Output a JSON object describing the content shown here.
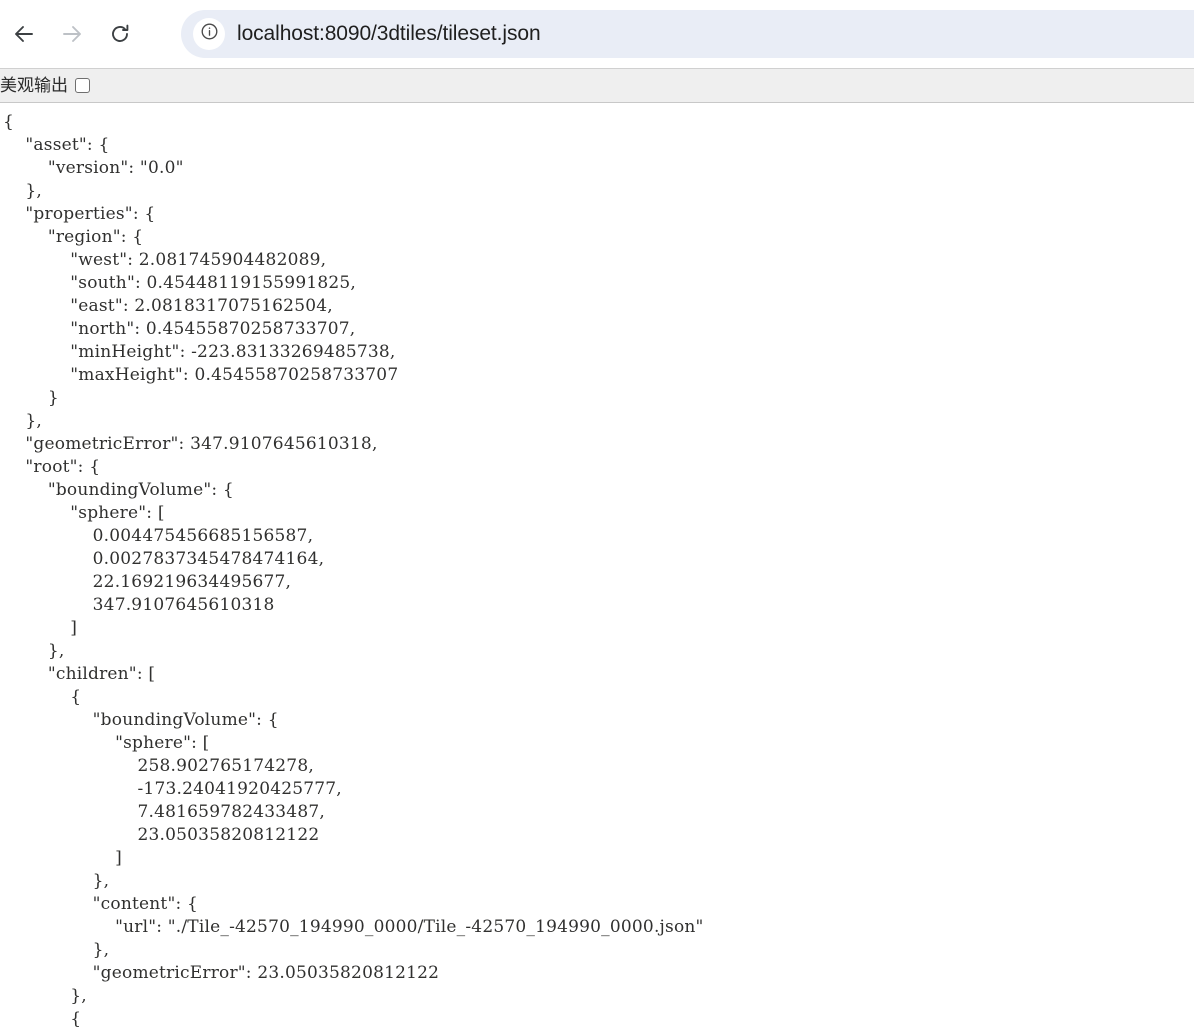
{
  "browser": {
    "back_label": "Back",
    "forward_label": "Forward",
    "reload_label": "Reload",
    "site_info_label": "View site information",
    "url": "localhost:8090/3dtiles/tileset.json"
  },
  "toolbar": {
    "pretty_print_label": "美观输出",
    "pretty_print_checked": false
  },
  "colors": {
    "omnibox_background": "#e9edf6",
    "toolbar_background": "#efefef",
    "page_background": "#ffffff",
    "text": "#30302f",
    "nav_enabled": "#3c4043",
    "nav_disabled": "#bdc1c6"
  },
  "document": {
    "filename": "tileset.json",
    "text": "{\n    \"asset\": {\n        \"version\": \"0.0\"\n    },\n    \"properties\": {\n        \"region\": {\n            \"west\": 2.081745904482089,\n            \"south\": 0.45448119155991825,\n            \"east\": 2.0818317075162504,\n            \"north\": 0.45455870258733707,\n            \"minHeight\": -223.83133269485738,\n            \"maxHeight\": 0.45455870258733707\n        }\n    },\n    \"geometricError\": 347.9107645610318,\n    \"root\": {\n        \"boundingVolume\": {\n            \"sphere\": [\n                0.004475456685156587,\n                0.0027837345478474164,\n                22.169219634495677,\n                347.9107645610318\n            ]\n        },\n        \"children\": [\n            {\n                \"boundingVolume\": {\n                    \"sphere\": [\n                        258.902765174278,\n                        -173.24041920425777,\n                        7.481659782433487,\n                        23.05035820812122\n                    ]\n                },\n                \"content\": {\n                    \"url\": \"./Tile_-42570_194990_0000/Tile_-42570_194990_0000.json\"\n                },\n                \"geometricError\": 23.05035820812122\n            },\n            {"
  }
}
